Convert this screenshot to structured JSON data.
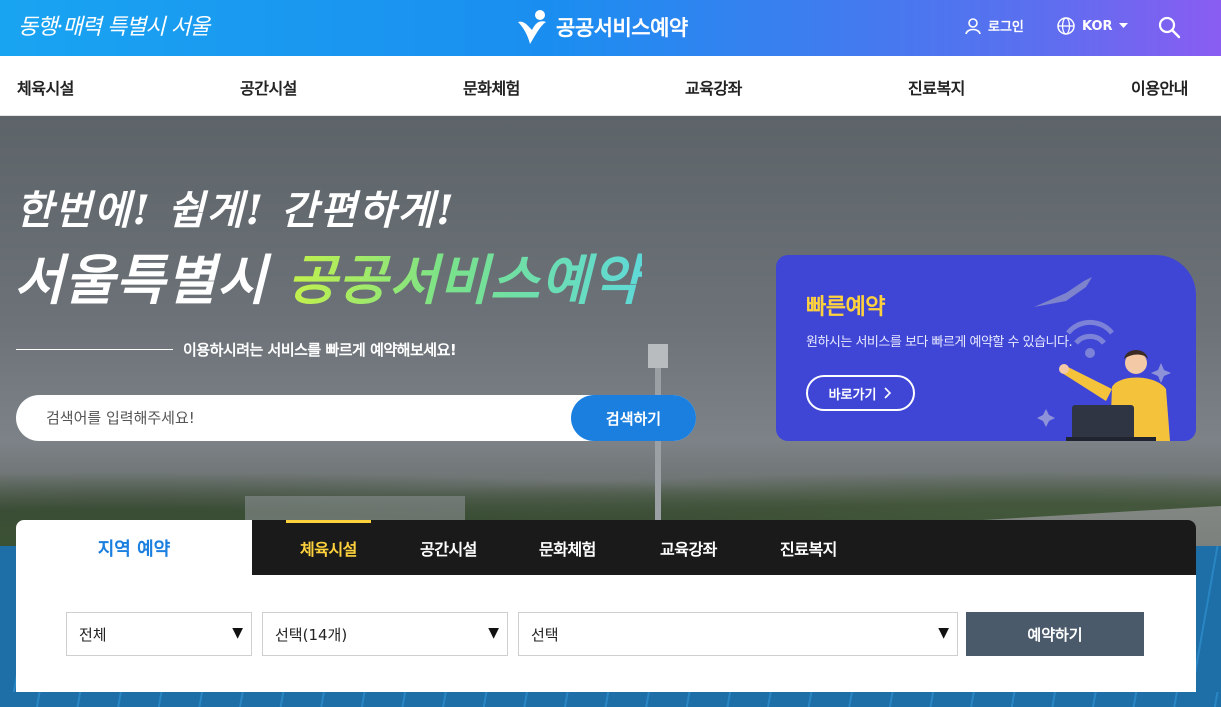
{
  "header": {
    "slogan": "동행·매력 특별시 서울",
    "brand": "공공서비스예약",
    "login_label": "로그인",
    "lang_label": "KOR",
    "brand_gradient": [
      "#19a4f1",
      "#8a5cf2"
    ]
  },
  "gnb": {
    "items": [
      "체육시설",
      "공간시설",
      "문화체험",
      "교육강좌",
      "진료복지",
      "이용안내"
    ]
  },
  "hero": {
    "line1": "한번에! 쉽게! 간편하게!",
    "line2_white": "서울특별시 ",
    "line2_green": "공공서비스예약",
    "subtitle": "이용하시려는 서비스를 빠르게 예약해보세요!",
    "search_placeholder": "검색어를 입력해주세요!",
    "search_button": "검색하기"
  },
  "quick": {
    "title": "빠른예약",
    "description": "원하시는 서비스를 보다 빠르게 예약할 수 있습니다.",
    "button": "바로가기",
    "background": "#3f46d6",
    "title_color": "#ffd23d"
  },
  "panel": {
    "region_tab": "지역 예약",
    "categories": [
      "체육시설",
      "공간시설",
      "문화체험",
      "교육강좌",
      "진료복지"
    ],
    "active_category": "체육시설",
    "select_region": "전체",
    "select_category": "선택(14개)",
    "select_facility": "선택",
    "reserve_button": "예약하기"
  }
}
